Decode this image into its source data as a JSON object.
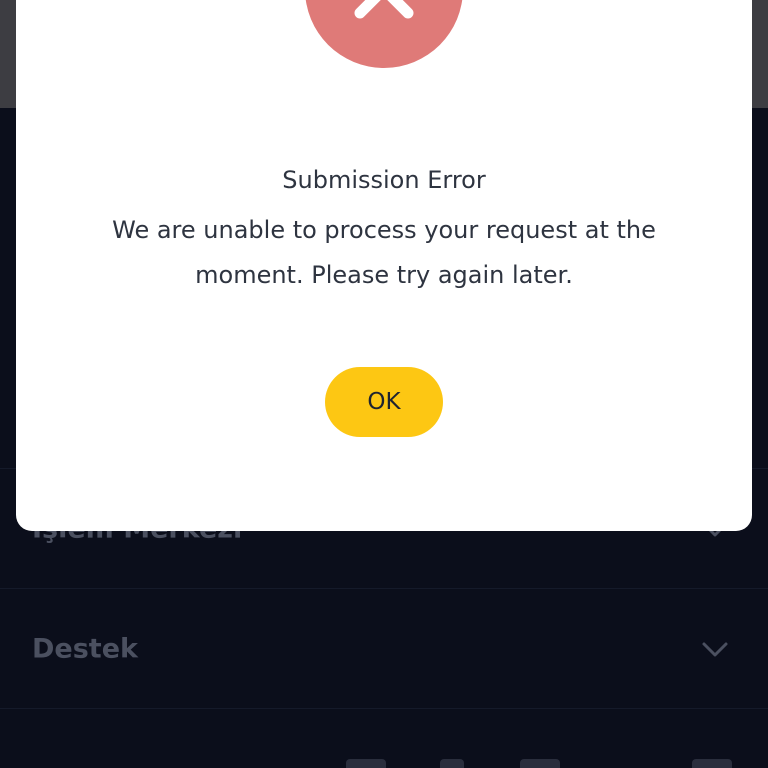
{
  "background": {
    "menu_items": [
      {
        "label": "İşlem Merkezi"
      },
      {
        "label": "Destek"
      }
    ]
  },
  "dialog": {
    "title": "Submission Error",
    "message": "We are unable to process your request at the moment. Please try again later.",
    "ok_label": "OK",
    "icon": "close-x-icon",
    "colors": {
      "icon_bg": "#df7a78",
      "button_bg": "#fdc713",
      "app_bg": "#0b0e1b"
    }
  }
}
